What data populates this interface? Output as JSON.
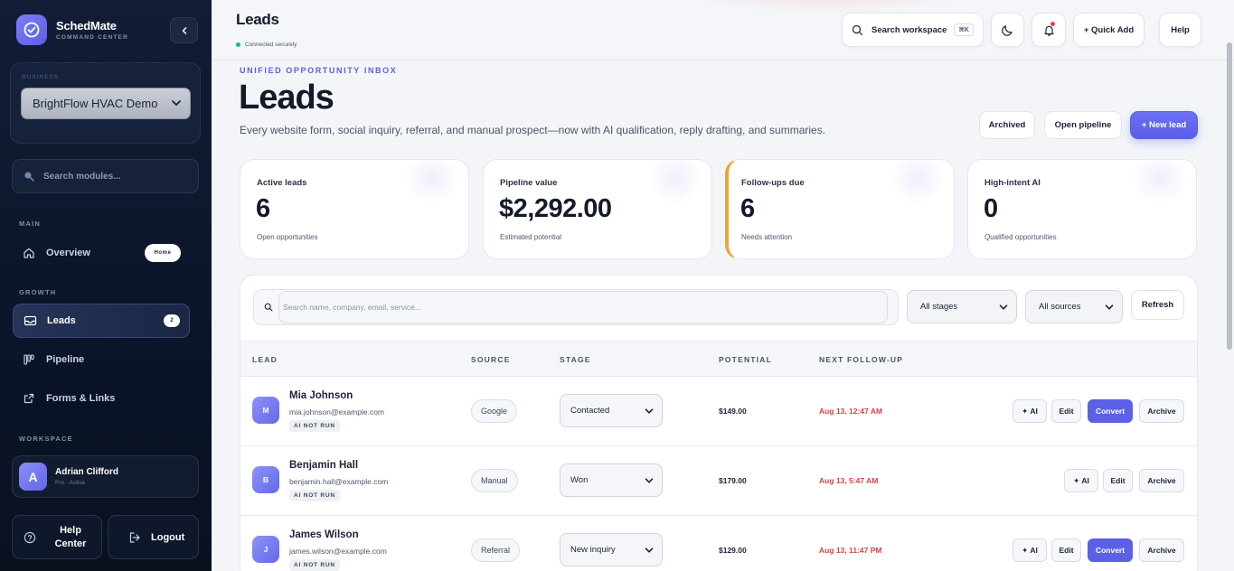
{
  "brand": {
    "name": "SchedMate",
    "subtitle": "COMMAND CENTER"
  },
  "business": {
    "label": "BUSINESS",
    "selected": "BrightFlow HVAC Demo"
  },
  "module_search": {
    "placeholder": "Search modules..."
  },
  "nav": {
    "main_label": "MAIN",
    "overview": "Overview",
    "overview_badge": "Home",
    "growth_label": "GROWTH",
    "leads": "Leads",
    "leads_badge": "2",
    "pipeline": "Pipeline",
    "forms": "Forms & Links",
    "workspace_label": "WORKSPACE"
  },
  "user": {
    "initial": "A",
    "name": "Adrian Clifford",
    "plan": "Pro · Active"
  },
  "footer": {
    "help": "Help Center",
    "logout": "Logout"
  },
  "topbar": {
    "title": "Leads",
    "status": "Connected securely",
    "search": "Search workspace",
    "shortcut": "⌘K",
    "quick_add": "+ Quick Add",
    "help": "Help"
  },
  "hero": {
    "eyebrow": "UNIFIED OPPORTUNITY INBOX",
    "title": "Leads",
    "description": "Every website form, social inquiry, referral, and manual prospect—now with AI qualification, reply drafting, and summaries.",
    "archived": "Archived",
    "open_pipeline": "Open pipeline",
    "new_lead": "+ New lead"
  },
  "stats": [
    {
      "label": "Active leads",
      "value": "6",
      "sub": "Open opportunities"
    },
    {
      "label": "Pipeline value",
      "value": "$2,292.00",
      "sub": "Estimated potential"
    },
    {
      "label": "Follow-ups due",
      "value": "6",
      "sub": "Needs attention"
    },
    {
      "label": "High-intent AI",
      "value": "0",
      "sub": "Qualified opportunities"
    }
  ],
  "filters": {
    "search_placeholder": "Search name, company, email, service...",
    "stage": "All stages",
    "source": "All sources",
    "refresh": "Refresh"
  },
  "table": {
    "headers": {
      "lead": "LEAD",
      "source": "SOURCE",
      "stage": "STAGE",
      "potential": "POTENTIAL",
      "followup": "NEXT FOLLOW-UP"
    },
    "actions": {
      "ai": "✦ AI",
      "edit": "Edit",
      "convert": "Convert",
      "archive": "Archive"
    },
    "rows": [
      {
        "initial": "M",
        "name": "Mia Johnson",
        "email": "mia.johnson@example.com",
        "ai_status": "AI NOT RUN",
        "source": "Google",
        "stage": "Contacted",
        "potential": "$149.00",
        "followup": "Aug 13, 12:47 AM"
      },
      {
        "initial": "B",
        "name": "Benjamin Hall",
        "email": "benjamin.hall@example.com",
        "ai_status": "AI NOT RUN",
        "source": "Manual",
        "stage": "Won",
        "potential": "$179.00",
        "followup": "Aug 13, 5:47 AM"
      },
      {
        "initial": "J",
        "name": "James Wilson",
        "email": "james.wilson@example.com",
        "ai_status": "AI NOT RUN",
        "source": "Referral",
        "stage": "New inquiry",
        "potential": "$129.00",
        "followup": "Aug 13, 11:47 PM"
      }
    ]
  }
}
